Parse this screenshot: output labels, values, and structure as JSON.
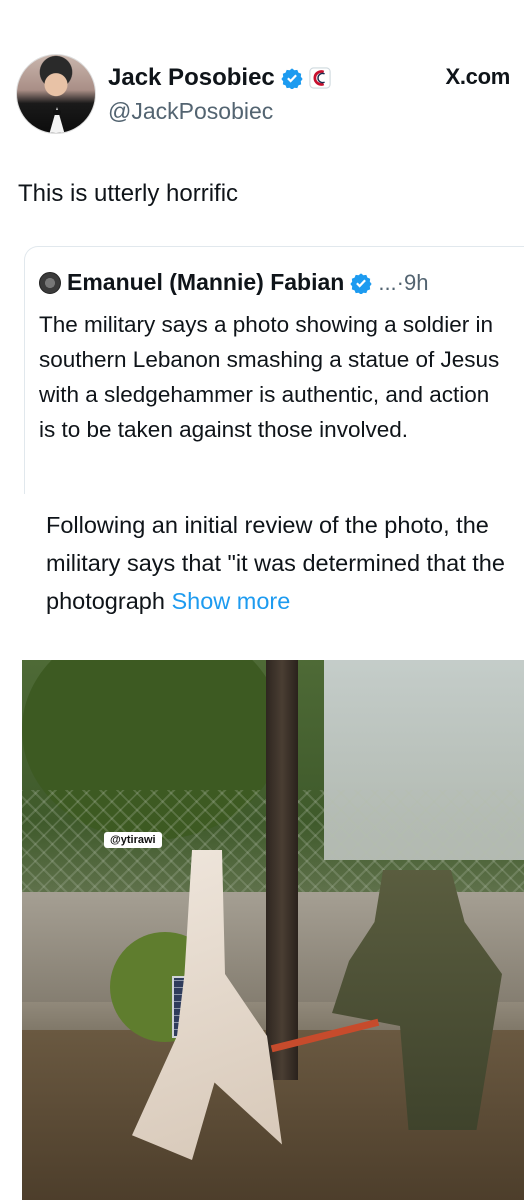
{
  "author": {
    "display_name": "Jack Posobiec",
    "handle": "@JackPosobiec",
    "verified_icon": "verified-badge-icon",
    "affiliation_icon": "affiliation-badge-icon"
  },
  "site_label": "X.com",
  "tweet": {
    "text": "This is utterly horrific"
  },
  "quoted_tweet": {
    "display_name": "Emanuel (Mannie) Fabian",
    "meta": "...·9h",
    "text": "The military says a photo showing a soldier in southern Lebanon smashing a statue of Jesus with a sledgehammer is authentic, and action is to be taken against those involved."
  },
  "continuation": {
    "text": "Following an initial review of the photo, the military says that \"it was determined that the photograph ",
    "show_more": "Show more"
  },
  "photo": {
    "watermark": "@ytirawi"
  },
  "colors": {
    "link": "#1d9bf0",
    "verified": "#1d9bf0",
    "secondary_text": "#536471"
  }
}
